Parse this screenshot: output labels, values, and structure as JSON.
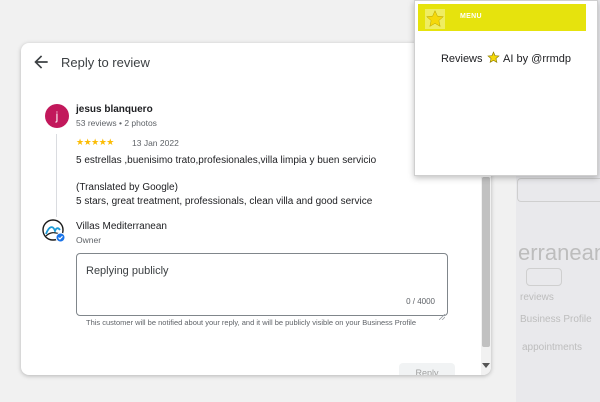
{
  "dialog": {
    "title": "Reply to review",
    "review": {
      "avatar_initial": "j",
      "reviewer_name": "jesus blanquero",
      "reviewer_meta": "53 reviews • 2 photos",
      "rating_stars": "★★★★★",
      "rating_value": 5,
      "date": "13 Jan 2022",
      "text": "5 estrellas ,buenisimo trato,profesionales,villa limpia y buen servicio",
      "translated_label": "(Translated by Google)",
      "translated_text": "5 stars, great treatment, professionals, clean villa and good service"
    },
    "owner": {
      "name": "Villas Mediterranean",
      "role": "Owner"
    },
    "reply": {
      "placeholder": "Replying publicly",
      "char_count": "0 / 4000",
      "notice": "This customer will be notified about your reply, and it will be publicly visible on your Business Profile",
      "button_label": "Reply"
    }
  },
  "extension": {
    "menu_label": "MENU",
    "title_prefix": "Reviews",
    "title_suffix": "AI by @rrmdp",
    "bar_color": "#e6e30d",
    "star_color": "#f5d90a"
  },
  "background": {
    "heading_fragment": "erranean",
    "line1": "reviews",
    "line2": "Business Profile",
    "line3": "appointments"
  },
  "colors": {
    "avatar": "#c2185b",
    "stars": "#fbbc04",
    "verified": "#1a73e8"
  }
}
